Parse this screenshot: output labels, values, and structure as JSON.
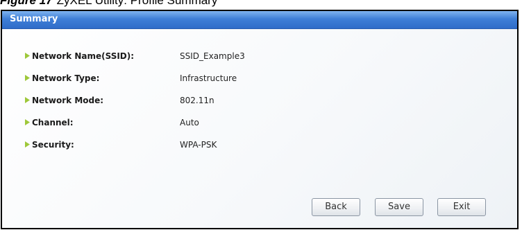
{
  "figure_caption": {
    "number": "Figure 17",
    "text": "ZyXEL Utility: Profile Summary"
  },
  "panel": {
    "title": "Summary"
  },
  "summary_rows": [
    {
      "label": "Network Name(SSID):",
      "value": "SSID_Example3"
    },
    {
      "label": "Network Type:",
      "value": "Infrastructure"
    },
    {
      "label": "Network Mode:",
      "value": "802.11n"
    },
    {
      "label": "Channel:",
      "value": "Auto"
    },
    {
      "label": "Security:",
      "value": "WPA-PSK"
    }
  ],
  "buttons": {
    "back": "Back",
    "save": "Save",
    "exit": "Exit"
  },
  "colors": {
    "header_gradient_top": "#7fb3ef",
    "header_gradient_bottom": "#2f6cc9",
    "bullet": "#9ec83a"
  },
  "icons": {
    "bullet": "triangle-bullet-icon"
  }
}
